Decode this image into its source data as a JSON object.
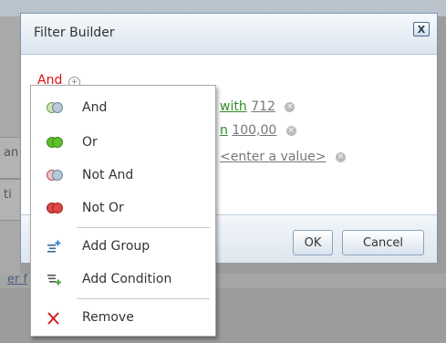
{
  "dialog": {
    "title": "Filter Builder",
    "close_glyph": "X",
    "group_operator": "And",
    "conditions": [
      {
        "op_fragment": "with",
        "value": "712"
      },
      {
        "op_fragment": "n",
        "value": "100,00"
      },
      {
        "op_fragment": "",
        "value": "<enter a value>"
      }
    ],
    "ok_label": "OK",
    "cancel_label": "Cancel"
  },
  "background": {
    "fragment_1": "an",
    "fragment_2": "ti",
    "link_fragment": "er f"
  },
  "context_menu": {
    "items": [
      {
        "label": "And",
        "icon": "and-group-icon"
      },
      {
        "label": "Or",
        "icon": "or-group-icon"
      },
      {
        "label": "Not And",
        "icon": "not-and-group-icon"
      },
      {
        "label": "Not Or",
        "icon": "not-or-group-icon"
      },
      {
        "label": "Add Group",
        "icon": "add-group-icon"
      },
      {
        "label": "Add Condition",
        "icon": "add-condition-icon"
      },
      {
        "label": "Remove",
        "icon": "remove-icon"
      }
    ]
  },
  "colors": {
    "group_operator": "#dd1111",
    "condition_operator": "#2f8b2a",
    "remove": "#d02020"
  }
}
